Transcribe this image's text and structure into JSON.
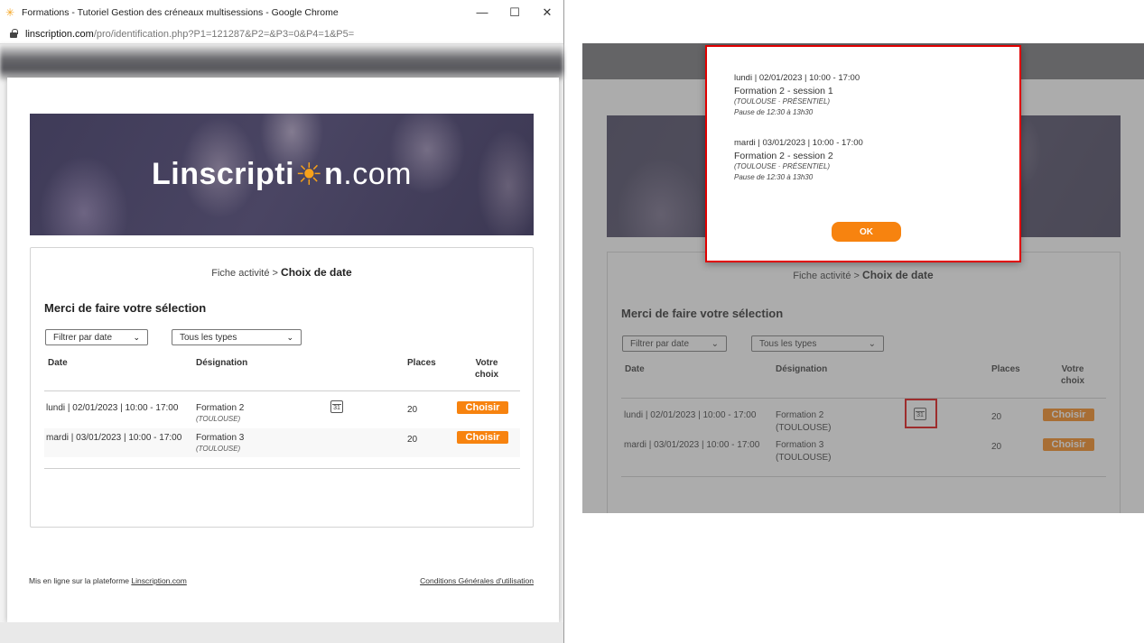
{
  "window": {
    "title": "Formations - Tutoriel Gestion des créneaux multisessions - Google Chrome",
    "url_host": "linscription.com",
    "url_path": "/pro/identification.php?P1=121287&P2=&P3=0&P4=1&P5="
  },
  "brand": {
    "logo_prefix": "Linscripti",
    "logo_mid": "n",
    "logo_suffix": ".com"
  },
  "breadcrumb": {
    "parent": "Fiche activité",
    "separator": ">",
    "current": "Choix de date"
  },
  "selection": {
    "heading": "Merci de faire votre sélection",
    "filter_date": "Filtrer par date",
    "filter_type": "Tous les types"
  },
  "table": {
    "headers": {
      "date": "Date",
      "designation": "Désignation",
      "places": "Places",
      "choice_line1": "Votre",
      "choice_line2": "choix"
    },
    "rows": [
      {
        "date": "lundi | 02/01/2023 | 10:00 - 17:00",
        "name": "Formation 2",
        "location": "(TOULOUSE)",
        "calendar_day": "31",
        "places": "20",
        "action": "Choisir"
      },
      {
        "date": "mardi | 03/01/2023 | 10:00 - 17:00",
        "name": "Formation 3",
        "location": "(TOULOUSE)",
        "places": "20",
        "action": "Choisir"
      }
    ]
  },
  "footer": {
    "left_prefix": "Mis en ligne sur la plateforme",
    "left_link": "Linscription.com",
    "right_link": "Conditions Générales d'utilisation"
  },
  "modal": {
    "sessions": [
      {
        "datetime": "lundi | 02/01/2023 | 10:00 - 17:00",
        "title": "Formation 2 - session 1",
        "location": "(TOULOUSE · PRÉSENTIEL)",
        "pause": "Pause de 12:30 à 13h30"
      },
      {
        "datetime": "mardi | 03/01/2023 | 10:00 - 17:00",
        "title": "Formation 2 - session 2",
        "location": "(TOULOUSE · PRÉSENTIEL)",
        "pause": "Pause de 12:30 à 13h30"
      }
    ],
    "ok_label": "OK"
  },
  "colors": {
    "accent": "#f7830f",
    "highlight": "#e00000",
    "banner": "#45405d"
  }
}
